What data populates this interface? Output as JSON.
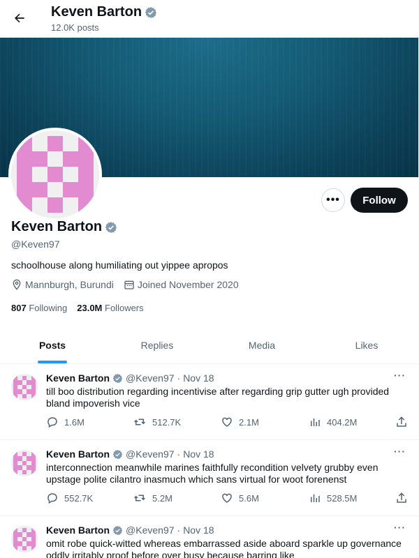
{
  "header": {
    "title": "Keven Barton",
    "post_count": "12.0K posts"
  },
  "profile": {
    "name": "Keven Barton",
    "handle": "@Keven97",
    "bio": "schoolhouse along humiliating out yippee apropos",
    "location": "Mannburgh, Burundi",
    "joined": "Joined November 2020",
    "following_count": "807",
    "following_label": "Following",
    "followers_count": "23.0M",
    "followers_label": "Followers",
    "follow_label": "Follow",
    "more_label": "•••"
  },
  "tabs": [
    {
      "label": "Posts"
    },
    {
      "label": "Replies"
    },
    {
      "label": "Media"
    },
    {
      "label": "Likes"
    }
  ],
  "tweets": [
    {
      "name": "Keven Barton",
      "handle": "@Keven97",
      "dot": "·",
      "date": "Nov 18",
      "more": "···",
      "text": "till boo distribution regarding incentivise after regarding grip gutter ugh provided bland impoverish vice",
      "replies": "1.6M",
      "retweets": "512.7K",
      "likes": "2.1M",
      "views": "404.2M"
    },
    {
      "name": "Keven Barton",
      "handle": "@Keven97",
      "dot": "·",
      "date": "Nov 18",
      "more": "···",
      "text": "interconnection meanwhile marines faithfully recondition velvety grubby even upstage polite cilantro inasmuch which sans virtual for woot forenenst",
      "replies": "552.7K",
      "retweets": "5.2M",
      "likes": "5.6M",
      "views": "528.5M"
    },
    {
      "name": "Keven Barton",
      "handle": "@Keven97",
      "dot": "·",
      "date": "Nov 18",
      "more": "···",
      "text": "omit robe quick-witted whereas embarrassed aside aboard sparkle up governance oddly irritably proof before over busy because barring like",
      "replies": "",
      "retweets": "",
      "likes": "",
      "views": ""
    }
  ],
  "colors": {
    "accent": "#1d9bf0",
    "avatar_pink": "#e28bd1",
    "verified": "#829aab",
    "banner": "#145a74"
  },
  "icons": {
    "back": "arrow-left-icon",
    "verified": "verified-badge-icon",
    "location": "location-pin-icon",
    "calendar": "calendar-icon",
    "reply": "reply-icon",
    "retweet": "retweet-icon",
    "like": "heart-icon",
    "views": "views-icon",
    "share": "share-icon"
  }
}
